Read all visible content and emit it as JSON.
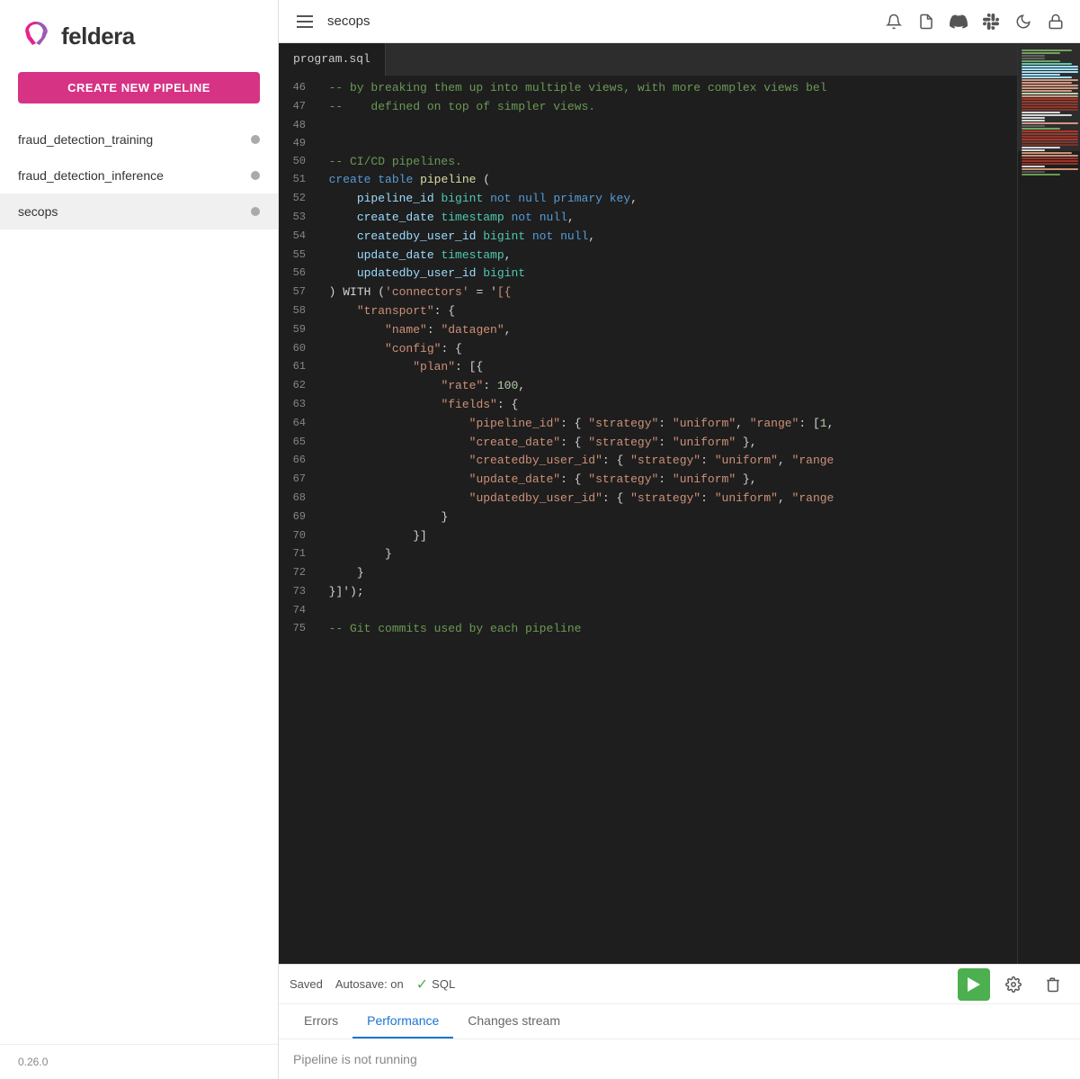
{
  "sidebar": {
    "logo_text": "feldera",
    "create_pipeline_label": "CREATE NEW PIPELINE",
    "pipelines": [
      {
        "name": "fraud_detection_training",
        "status": "inactive"
      },
      {
        "name": "fraud_detection_inference",
        "status": "inactive"
      },
      {
        "name": "secops",
        "status": "inactive",
        "active": true
      }
    ],
    "version": "0.26.0"
  },
  "topbar": {
    "title": "secops",
    "icons": [
      "bell-icon",
      "document-icon",
      "discord-icon",
      "slack-icon",
      "theme-icon",
      "lock-icon"
    ]
  },
  "file_tabs": [
    {
      "name": "program.sql",
      "active": true
    }
  ],
  "code_lines": [
    {
      "num": 46,
      "content": "  -- by breaking them up into multiple views, with more complex views bel"
    },
    {
      "num": 47,
      "content": "  --    defined on top of simpler views."
    },
    {
      "num": 48,
      "content": ""
    },
    {
      "num": 49,
      "content": ""
    },
    {
      "num": 50,
      "content": "  -- CI/CD pipelines."
    },
    {
      "num": 51,
      "content": "  create table pipeline ("
    },
    {
      "num": 52,
      "content": "      pipeline_id bigint not null primary key,"
    },
    {
      "num": 53,
      "content": "      create_date timestamp not null,"
    },
    {
      "num": 54,
      "content": "      createdby_user_id bigint not null,"
    },
    {
      "num": 55,
      "content": "      update_date timestamp,"
    },
    {
      "num": 56,
      "content": "      updatedby_user_id bigint"
    },
    {
      "num": 57,
      "content": "  ) WITH ('connectors' = '[{"
    },
    {
      "num": 58,
      "content": "      \"transport\": {"
    },
    {
      "num": 59,
      "content": "          \"name\": \"datagen\","
    },
    {
      "num": 60,
      "content": "          \"config\": {"
    },
    {
      "num": 61,
      "content": "              \"plan\": [{"
    },
    {
      "num": 62,
      "content": "                  \"rate\": 100,"
    },
    {
      "num": 63,
      "content": "                  \"fields\": {"
    },
    {
      "num": 64,
      "content": "                      \"pipeline_id\": { \"strategy\": \"uniform\", \"range\": [1,"
    },
    {
      "num": 65,
      "content": "                      \"create_date\": { \"strategy\": \"uniform\" },"
    },
    {
      "num": 66,
      "content": "                      \"createdby_user_id\": { \"strategy\": \"uniform\", \"range"
    },
    {
      "num": 67,
      "content": "                      \"update_date\": { \"strategy\": \"uniform\" },"
    },
    {
      "num": 68,
      "content": "                      \"updatedby_user_id\": { \"strategy\": \"uniform\", \"range"
    },
    {
      "num": 69,
      "content": "                  }"
    },
    {
      "num": 70,
      "content": "              }]"
    },
    {
      "num": 71,
      "content": "          }"
    },
    {
      "num": 72,
      "content": "      }"
    },
    {
      "num": 73,
      "content": "  }]');"
    },
    {
      "num": 74,
      "content": ""
    },
    {
      "num": 75,
      "content": "  -- Git commits used by each pipeline"
    }
  ],
  "bottom_toolbar": {
    "saved_label": "Saved",
    "autosave_label": "Autosave: on",
    "sql_label": "SQL",
    "run_button_label": "▶",
    "settings_label": "⚙",
    "delete_label": "🗑"
  },
  "bottom_tabs": [
    {
      "label": "Errors",
      "active": false
    },
    {
      "label": "Performance",
      "active": true
    },
    {
      "label": "Changes stream",
      "active": false
    }
  ],
  "bottom_content": {
    "status_message": "Pipeline is not running"
  }
}
